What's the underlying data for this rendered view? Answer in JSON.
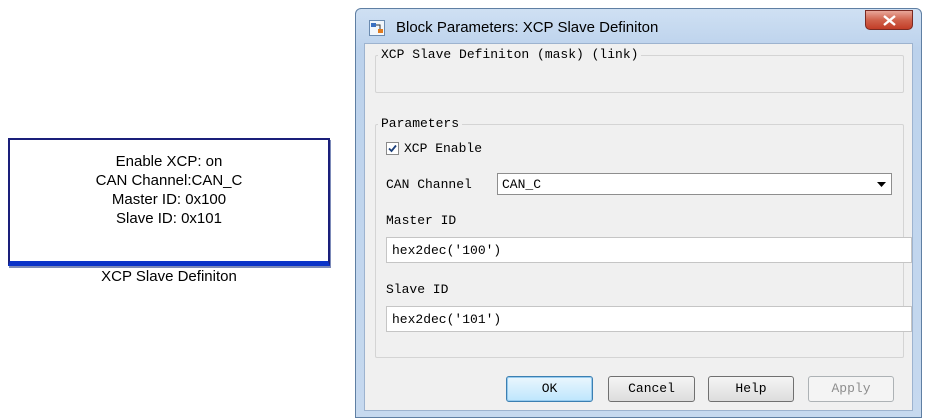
{
  "block": {
    "lines": [
      "Enable XCP: on",
      "CAN Channel:CAN_C",
      "Master ID: 0x100",
      "Slave ID: 0x101"
    ],
    "name": "XCP Slave Definiton"
  },
  "dialog": {
    "title": "Block Parameters: XCP Slave Definiton",
    "mask_group_label": "XCP Slave Definiton (mask) (link)",
    "parameters_group_label": "Parameters",
    "xcp_enable": {
      "label": "XCP Enable",
      "checked": true
    },
    "can_channel": {
      "label": "CAN Channel",
      "value": "CAN_C"
    },
    "master_id": {
      "label": "Master ID",
      "value": "hex2dec('100')"
    },
    "slave_id": {
      "label": "Slave ID",
      "value": "hex2dec('101')"
    },
    "buttons": {
      "ok": "OK",
      "cancel": "Cancel",
      "help": "Help",
      "apply": "Apply"
    }
  }
}
